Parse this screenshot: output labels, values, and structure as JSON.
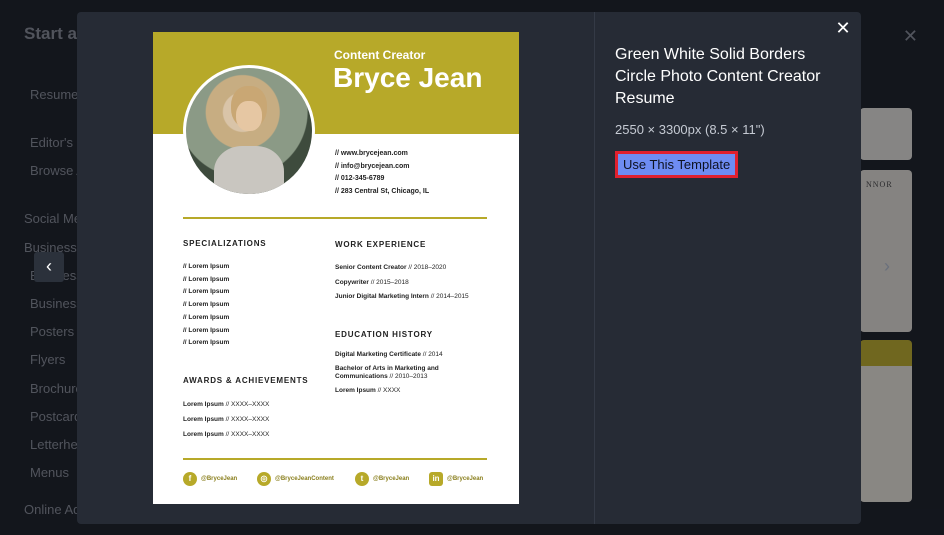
{
  "background": {
    "header_title": "Start a",
    "close_glyph": "✕",
    "sidebar": [
      {
        "label": "Resume"
      },
      {
        "label": "Editor's C"
      },
      {
        "label": "Browse A"
      },
      {
        "label": "Social Me"
      },
      {
        "label": "Business I"
      },
      {
        "label": "Business"
      },
      {
        "label": "Business"
      },
      {
        "label": "Posters"
      },
      {
        "label": "Flyers"
      },
      {
        "label": "Brochure"
      },
      {
        "label": "Postcard"
      },
      {
        "label": "Letterhe"
      },
      {
        "label": "Menus"
      },
      {
        "label": "Online Ad"
      }
    ],
    "thumbnail_text": "NNOR"
  },
  "modal": {
    "close_glyph": "✕",
    "prev_glyph": "‹",
    "next_glyph": "›",
    "title": "Green White Solid Borders Circle Photo Content Creator Resume",
    "dimensions": "2550 × 3300px (8.5 × 11\")",
    "use_button": "Use This Template"
  },
  "resume": {
    "role": "Content Creator",
    "name": "Bryce Jean",
    "contact": [
      "// www.brycejean.com",
      "// info@brycejean.com",
      "// 012-345-6789",
      "// 283 Central St, Chicago, IL"
    ],
    "specializations_title": "SPECIALIZATIONS",
    "specializations": [
      "// Lorem Ipsum",
      "// Lorem Ipsum",
      "// Lorem Ipsum",
      "// Lorem Ipsum",
      "// Lorem Ipsum",
      "// Lorem Ipsum",
      "// Lorem Ipsum"
    ],
    "awards_title": "AWARDS & ACHIEVEMENTS",
    "awards": [
      {
        "name": "Lorem Ipsum",
        "detail": " // XXXX–XXXX"
      },
      {
        "name": "Lorem Ipsum",
        "detail": " // XXXX–XXXX"
      },
      {
        "name": "Lorem Ipsum",
        "detail": " // XXXX–XXXX"
      }
    ],
    "work_title": "WORK EXPERIENCE",
    "work": [
      {
        "role": "Senior Content Creator",
        "dates": " // 2018–2020"
      },
      {
        "role": "Copywriter",
        "dates": " // 2015–2018"
      },
      {
        "role": "Junior Digital Marketing Intern",
        "dates": " // 2014–2015"
      }
    ],
    "education_title": "EDUCATION HISTORY",
    "education": [
      {
        "degree": "Digital Marketing Certificate",
        "dates": " // 2014"
      },
      {
        "degree": "Bachelor of Arts in Marketing and Communications",
        "dates": " // 2010–2013"
      },
      {
        "degree": "Lorem Ipsum",
        "dates": " // XXXX"
      }
    ],
    "socials": [
      {
        "icon": "f",
        "handle": "@BryceJean"
      },
      {
        "icon": "◎",
        "handle": "@BryceJeanContent"
      },
      {
        "icon": "t",
        "handle": "@BryceJean"
      },
      {
        "icon": "in",
        "handle": "@BryceJean"
      }
    ],
    "accent_color": "#b7a929"
  }
}
